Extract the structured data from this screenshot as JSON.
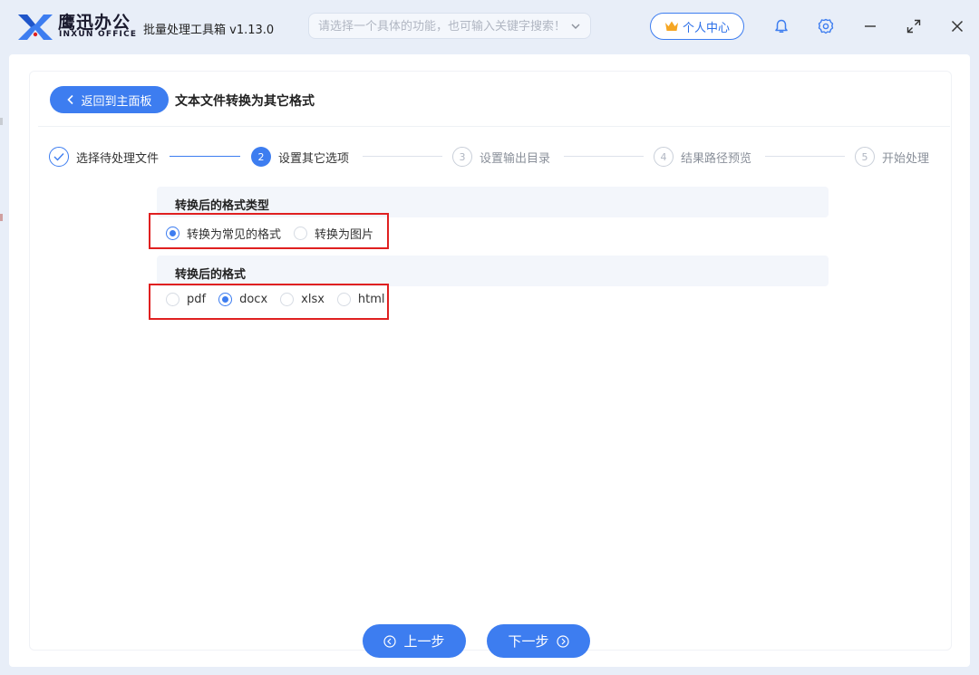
{
  "app": {
    "brand_cn": "鹰迅办公",
    "brand_en": "INXUN OFFICE",
    "title": "批量处理工具箱 v1.13.0"
  },
  "search": {
    "placeholder": "请选择一个具体的功能，也可输入关键字搜索！"
  },
  "titlebar": {
    "user_center_label": "个人中心",
    "icons": [
      "crown-icon",
      "bell-icon",
      "gear-icon",
      "minimize-icon",
      "maximize-icon",
      "close-icon"
    ]
  },
  "header": {
    "back_label": "返回到主面板",
    "page_title": "文本文件转换为其它格式"
  },
  "steps": [
    {
      "num": "",
      "label": "选择待处理文件",
      "state": "done"
    },
    {
      "num": "2",
      "label": "设置其它选项",
      "state": "active"
    },
    {
      "num": "3",
      "label": "设置输出目录",
      "state": "todo"
    },
    {
      "num": "4",
      "label": "结果路径预览",
      "state": "todo"
    },
    {
      "num": "5",
      "label": "开始处理",
      "state": "todo"
    }
  ],
  "format_type": {
    "title": "转换后的格式类型",
    "options": [
      "转换为常见的格式",
      "转换为图片"
    ],
    "selected": "转换为常见的格式"
  },
  "format": {
    "title": "转换后的格式",
    "options": [
      "pdf",
      "docx",
      "xlsx",
      "html"
    ],
    "selected": "docx"
  },
  "footer": {
    "prev_label": "上一步",
    "next_label": "下一步"
  },
  "colors": {
    "accent": "#3d7df0",
    "highlight_box": "#e02020",
    "background": "#e8eef8"
  }
}
